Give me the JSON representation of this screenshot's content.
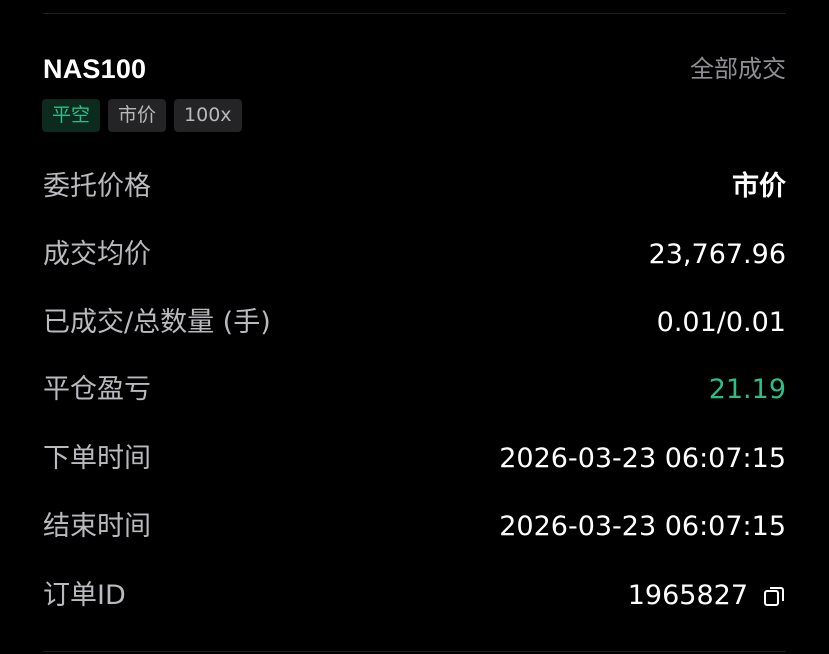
{
  "order": {
    "symbol": "NAS100",
    "status_link": "全部成交",
    "tags": [
      "平空",
      "市价",
      "100x"
    ],
    "colors": {
      "profit": "#2ebd85",
      "background": "#000000",
      "label": "#b9b9be"
    }
  },
  "details": [
    {
      "label": "委托价格",
      "value": "市价"
    },
    {
      "label": "成交均价",
      "value": "23,767.96"
    },
    {
      "label": "已成交/总数量 (手)",
      "value": "0.01/0.01"
    },
    {
      "label": "平仓盈亏",
      "value": "21.19"
    },
    {
      "label": "下单时间",
      "value": "2026-03-23 06:07:15"
    },
    {
      "label": "结束时间",
      "value": "2026-03-23 06:07:15"
    },
    {
      "label": "订单ID",
      "value": "1965827",
      "icon": "copy-icon"
    }
  ]
}
